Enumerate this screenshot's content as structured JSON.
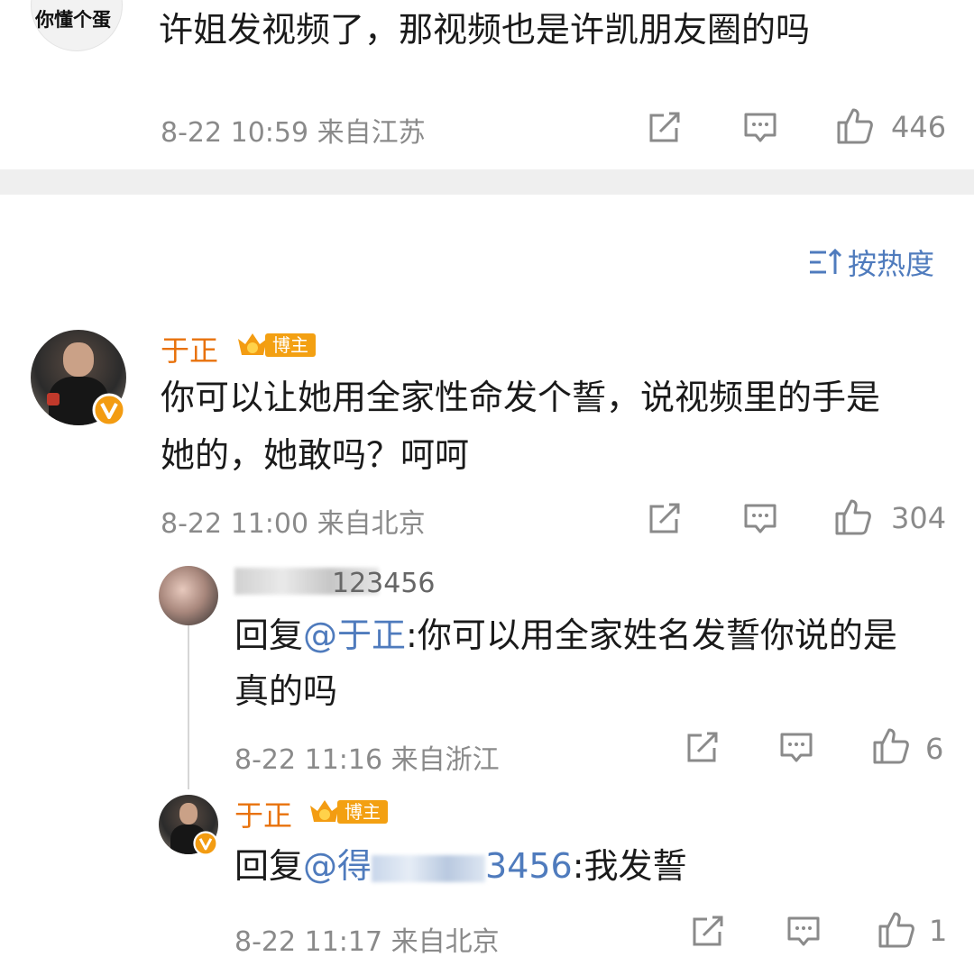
{
  "top_comment": {
    "avatar_text": "你懂个蛋",
    "text": "许姐发视频了，那视频也是许凯朋友圈的吗",
    "meta": "8-22 10:59 来自江苏",
    "likes": "446"
  },
  "sort": {
    "label": "按热度"
  },
  "comment": {
    "author": "于正",
    "badge": "博主",
    "line1": "你可以让她用全家性命发个誓，说视频里的手是",
    "line2": "她的，她敢吗？呵呵",
    "meta": "8-22 11:00 来自北京",
    "likes": "304"
  },
  "reply1": {
    "author_visible": "123456",
    "prefix": "回复",
    "mention": "@于正",
    "text_line1": ":你可以用全家姓名发誓你说的是",
    "text_line2": "真的吗",
    "meta": "8-22 11:16 来自浙江",
    "likes": "6"
  },
  "reply2": {
    "author": "于正",
    "badge": "博主",
    "prefix": "回复",
    "mention_start": "@得",
    "mention_end": "3456",
    "text": ":我发誓",
    "meta": "8-22 11:17 来自北京",
    "likes": "1"
  },
  "colors": {
    "name": "#e8720c",
    "mention": "#4f7bbd",
    "badge": "#f3a012",
    "meta": "#8a8a8a"
  }
}
